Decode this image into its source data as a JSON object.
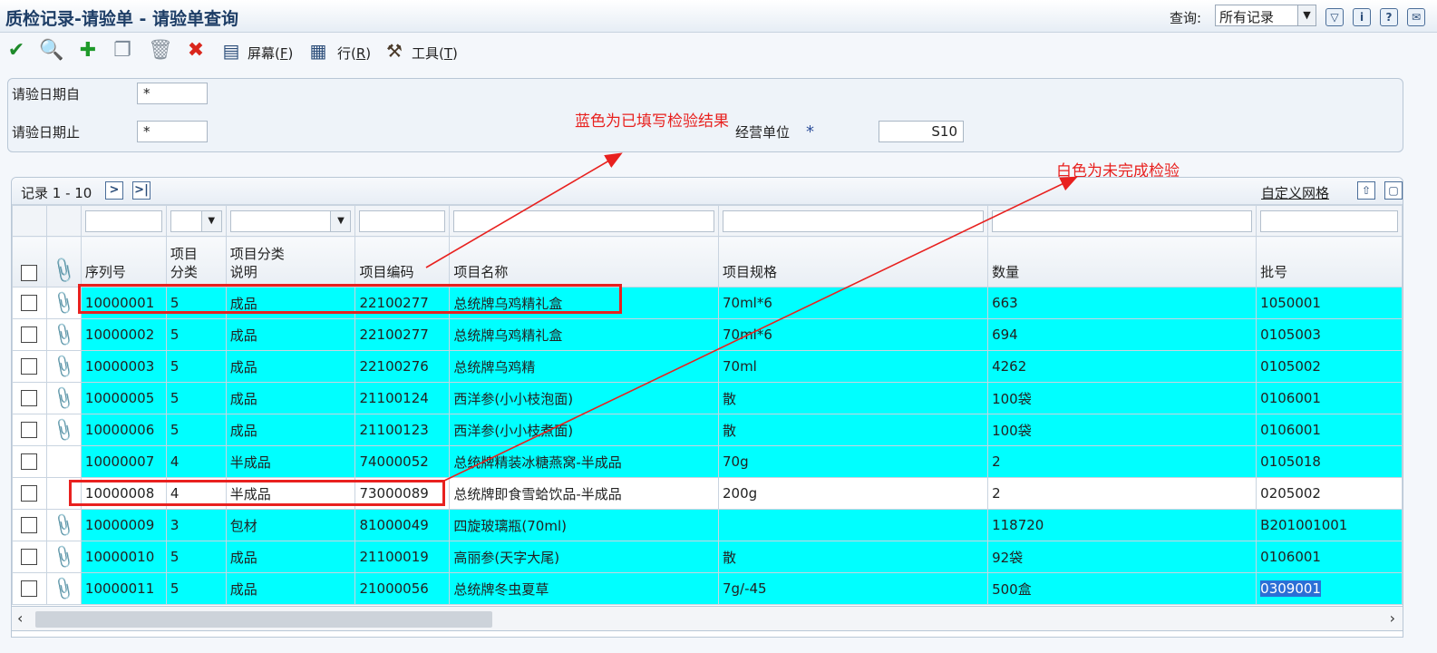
{
  "window": {
    "title": "质检记录-请验单 - 请验单查询",
    "query_label": "查询:",
    "query_value": "所有记录",
    "icons": [
      "filter-icon",
      "info-icon",
      "help-icon",
      "extra-icon"
    ]
  },
  "toolbar": {
    "screen_label": "屏幕(",
    "screen_key": "F",
    "row_label": "行(",
    "row_key": "R",
    "tools_label": "工具(",
    "tools_key": "T",
    "close_paren": ")"
  },
  "filter": {
    "date_from_label": "请验日期自",
    "date_from_value": "*",
    "date_to_label": "请验日期止",
    "date_to_value": "*",
    "unit_label": "经营单位",
    "unit_star": "*",
    "unit_value": "S10"
  },
  "annotations": {
    "blue_note": "蓝色为已填写检验结果",
    "white_note": "白色为未完成检验",
    "colors": {
      "annotation": "#e8211f",
      "done_row": "#00ffff",
      "pending_row": "#ffffff"
    }
  },
  "grid": {
    "record_label": "记录 1 - 10",
    "custom_grid_label": "自定义网格",
    "columns": [
      {
        "key": "seq",
        "label1": "",
        "label2": "序列号"
      },
      {
        "key": "cat",
        "label1": "项目",
        "label2": "分类"
      },
      {
        "key": "catdesc",
        "label1": "项目分类",
        "label2": "说明"
      },
      {
        "key": "code",
        "label1": "",
        "label2": "项目编码"
      },
      {
        "key": "name",
        "label1": "",
        "label2": "项目名称"
      },
      {
        "key": "spec",
        "label1": "",
        "label2": "项目规格"
      },
      {
        "key": "qty",
        "label1": "",
        "label2": "数量"
      },
      {
        "key": "batch",
        "label1": "",
        "label2": "批号"
      }
    ],
    "rows": [
      {
        "attach": true,
        "status": "done",
        "seq": "10000001",
        "cat": "5",
        "catdesc": "成品",
        "code": "22100277",
        "name": "总统牌乌鸡精礼盒",
        "spec": "70ml*6",
        "qty": "663",
        "batch": "1050001"
      },
      {
        "attach": true,
        "status": "done",
        "seq": "10000002",
        "cat": "5",
        "catdesc": "成品",
        "code": "22100277",
        "name": "总统牌乌鸡精礼盒",
        "spec": "70ml*6",
        "qty": "694",
        "batch": "0105003"
      },
      {
        "attach": true,
        "status": "done",
        "seq": "10000003",
        "cat": "5",
        "catdesc": "成品",
        "code": "22100276",
        "name": "总统牌乌鸡精",
        "spec": "70ml",
        "qty": "4262",
        "batch": "0105002"
      },
      {
        "attach": true,
        "status": "done",
        "seq": "10000005",
        "cat": "5",
        "catdesc": "成品",
        "code": "21100124",
        "name": "西洋参(小小枝泡面)",
        "spec": "散",
        "qty": "100袋",
        "batch": "0106001"
      },
      {
        "attach": true,
        "status": "done",
        "seq": "10000006",
        "cat": "5",
        "catdesc": "成品",
        "code": "21100123",
        "name": "西洋参(小小枝煮面)",
        "spec": "散",
        "qty": "100袋",
        "batch": "0106001"
      },
      {
        "attach": false,
        "status": "done",
        "seq": "10000007",
        "cat": "4",
        "catdesc": "半成品",
        "code": "74000052",
        "name": "总统牌精装冰糖燕窝-半成品",
        "spec": "70g",
        "qty": "2",
        "batch": "0105018"
      },
      {
        "attach": false,
        "status": "pending",
        "seq": "10000008",
        "cat": "4",
        "catdesc": "半成品",
        "code": "73000089",
        "name": "总统牌即食雪蛤饮品-半成品",
        "spec": "200g",
        "qty": "2",
        "batch": "0205002"
      },
      {
        "attach": true,
        "status": "done",
        "seq": "10000009",
        "cat": "3",
        "catdesc": "包材",
        "code": "81000049",
        "name": "四旋玻璃瓶(70ml)",
        "spec": "",
        "qty": "118720",
        "batch": "B201001001"
      },
      {
        "attach": true,
        "status": "done",
        "seq": "10000010",
        "cat": "5",
        "catdesc": "成品",
        "code": "21100019",
        "name": "高丽参(天字大尾)",
        "spec": "散",
        "qty": "92袋",
        "batch": "0106001"
      },
      {
        "attach": true,
        "status": "done",
        "seq": "10000011",
        "cat": "5",
        "catdesc": "成品",
        "code": "21000056",
        "name": "总统牌冬虫夏草",
        "spec": "7g/-45",
        "qty": "500盒",
        "batch": "0309001"
      }
    ]
  }
}
